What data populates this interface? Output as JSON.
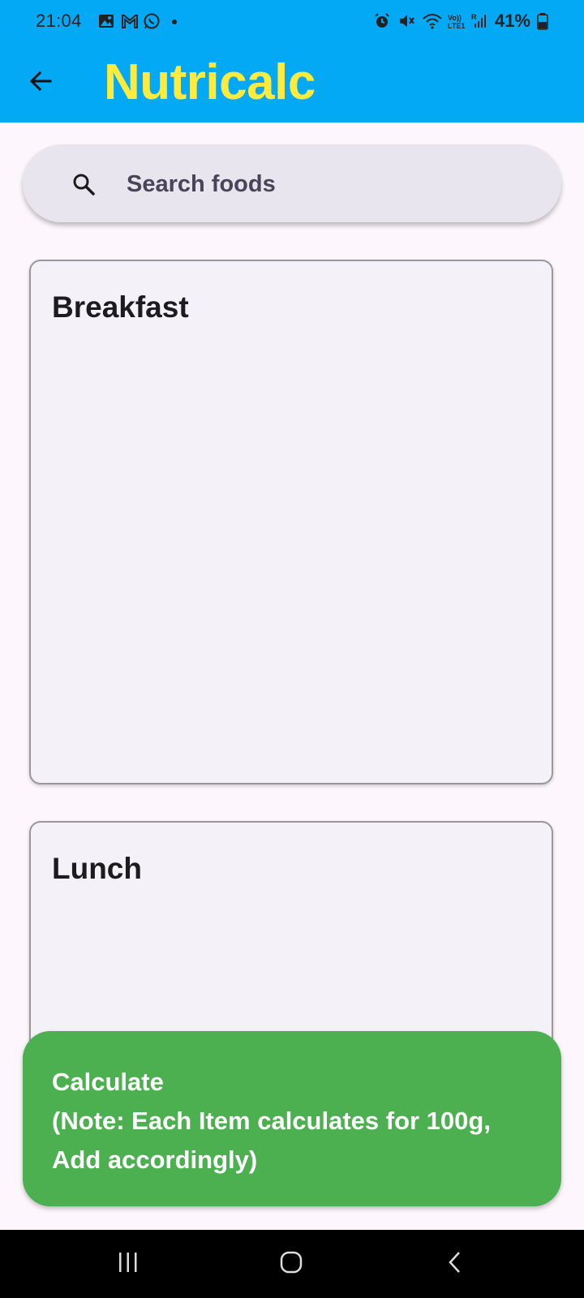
{
  "status_bar": {
    "time": "21:04",
    "battery": "41%",
    "left_icons": [
      "gallery-icon",
      "gmail-icon",
      "whatsapp-icon",
      "dot-icon"
    ],
    "right_icons": [
      "alarm-icon",
      "mute-icon",
      "wifi-icon",
      "volte-icon",
      "signal-icon",
      "battery-icon"
    ]
  },
  "app_bar": {
    "title": "Nutricalc",
    "back_icon": "arrow-back-icon",
    "background": "#03a9f4",
    "title_color": "#ffeb3b"
  },
  "search": {
    "placeholder": "Search foods",
    "value": "",
    "icon": "search-icon"
  },
  "meals": [
    {
      "label": "Breakfast"
    },
    {
      "label": "Lunch"
    }
  ],
  "calculate_button": {
    "line1": "Calculate",
    "line2": "(Note: Each Item calculates for 100g,",
    "line3": "Add accordingly)",
    "color": "#4caf50"
  },
  "nav_bar": {
    "items": [
      "recent-apps-icon",
      "home-icon",
      "back-icon"
    ]
  }
}
